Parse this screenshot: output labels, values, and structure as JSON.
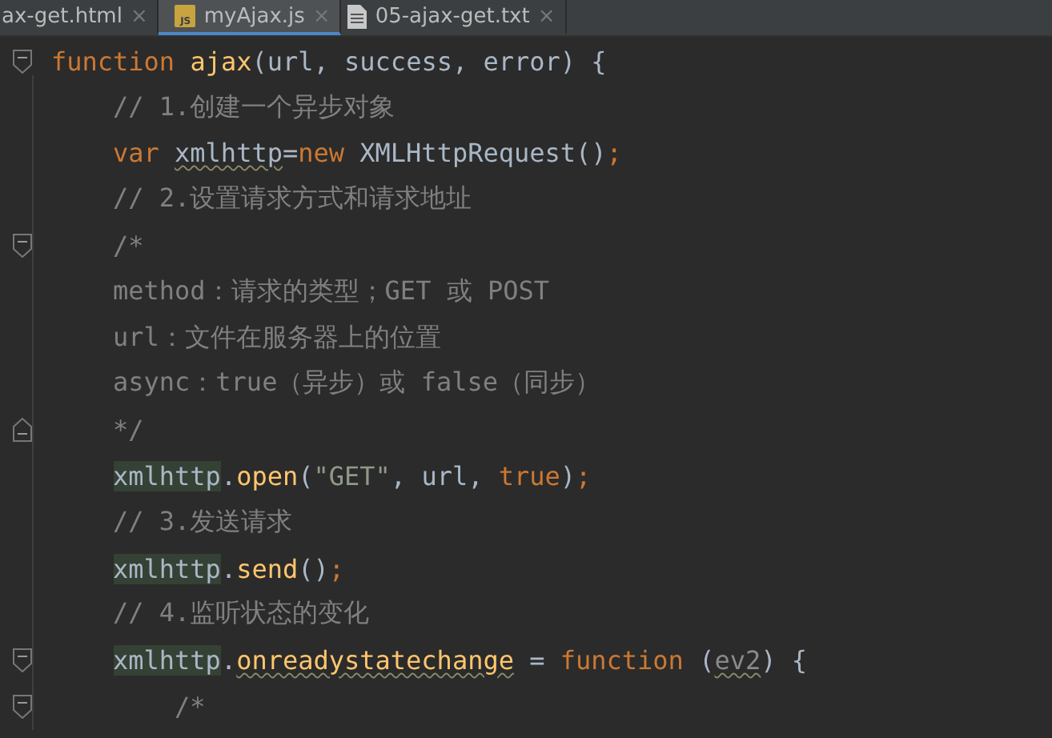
{
  "tabs": [
    {
      "label": "ax-get.html",
      "kind": "html",
      "selected": false
    },
    {
      "label": "myAjax.js",
      "kind": "js",
      "selected": true
    },
    {
      "label": "05-ajax-get.txt",
      "kind": "txt",
      "selected": false
    }
  ],
  "close_glyph": "×",
  "js_badge": "JS",
  "lines": [
    {
      "fold_start": true,
      "tokens": [
        {
          "kind": "kw",
          "text": "function"
        },
        {
          "kind": "fn",
          "text": " ajax"
        },
        {
          "kind": "plain",
          "text": "(url, success, error) {"
        }
      ],
      "children": [
        {
          "tokens": [
            {
              "kind": "comment",
              "text": "// 1.创建一个异步对象"
            }
          ]
        },
        {
          "tokens": [
            {
              "kind": "kw",
              "text": "var "
            },
            {
              "kind": "plain",
              "text": "xmlhttp",
              "underlined": true
            },
            {
              "kind": "plain",
              "text": "="
            },
            {
              "kind": "kw",
              "text": "new"
            },
            {
              "kind": "plain",
              "text": " XMLHttpRequest()"
            },
            {
              "kind": "semi",
              "text": ";"
            }
          ]
        },
        {
          "tokens": [
            {
              "kind": "comment",
              "text": "// 2.设置请求方式和请求地址"
            }
          ]
        },
        {
          "fold_start": true,
          "tokens": [
            {
              "kind": "comment",
              "text": "/*"
            }
          ]
        },
        {
          "tokens": [
            {
              "kind": "comment",
              "text": "method：请求的类型；GET 或 POST"
            }
          ]
        },
        {
          "tokens": [
            {
              "kind": "comment",
              "text": "url：文件在服务器上的位置"
            }
          ]
        },
        {
          "tokens": [
            {
              "kind": "comment",
              "text": "async：true（异步）或 false（同步）"
            }
          ]
        },
        {
          "fold_end": true,
          "tokens": [
            {
              "kind": "comment",
              "text": "*/"
            }
          ]
        },
        {
          "tokens": [
            {
              "kind": "plain",
              "text": "xmlhttp",
              "highlighted": true
            },
            {
              "kind": "plain",
              "text": "."
            },
            {
              "kind": "fn",
              "text": "open"
            },
            {
              "kind": "plain",
              "text": "("
            },
            {
              "kind": "str",
              "text": "\"GET\""
            },
            {
              "kind": "plain",
              "text": ", url, "
            },
            {
              "kind": "kw",
              "text": "true"
            },
            {
              "kind": "plain",
              "text": ")"
            },
            {
              "kind": "semi",
              "text": ";"
            }
          ]
        },
        {
          "tokens": [
            {
              "kind": "comment",
              "text": "// 3.发送请求"
            }
          ]
        },
        {
          "tokens": [
            {
              "kind": "plain",
              "text": "xmlhttp",
              "highlighted": true
            },
            {
              "kind": "plain",
              "text": "."
            },
            {
              "kind": "fn",
              "text": "send"
            },
            {
              "kind": "plain",
              "text": "()"
            },
            {
              "kind": "semi",
              "text": ";"
            }
          ]
        },
        {
          "tokens": [
            {
              "kind": "comment",
              "text": "// 4.监听状态的变化"
            }
          ]
        },
        {
          "fold_start": true,
          "tokens": [
            {
              "kind": "plain",
              "text": "xmlhttp",
              "highlighted": true
            },
            {
              "kind": "plain",
              "text": "."
            },
            {
              "kind": "fn",
              "text": "onreadystatechange",
              "underlined": true
            },
            {
              "kind": "plain",
              "text": " = "
            },
            {
              "kind": "kw",
              "text": "function "
            },
            {
              "kind": "plain",
              "text": "("
            },
            {
              "kind": "param",
              "text": "ev2",
              "underlined": true
            },
            {
              "kind": "plain",
              "text": ") {"
            }
          ],
          "children": [
            {
              "fold_start": true,
              "tokens": [
                {
                  "kind": "comment",
                  "text": "/*"
                }
              ]
            }
          ]
        }
      ]
    }
  ]
}
